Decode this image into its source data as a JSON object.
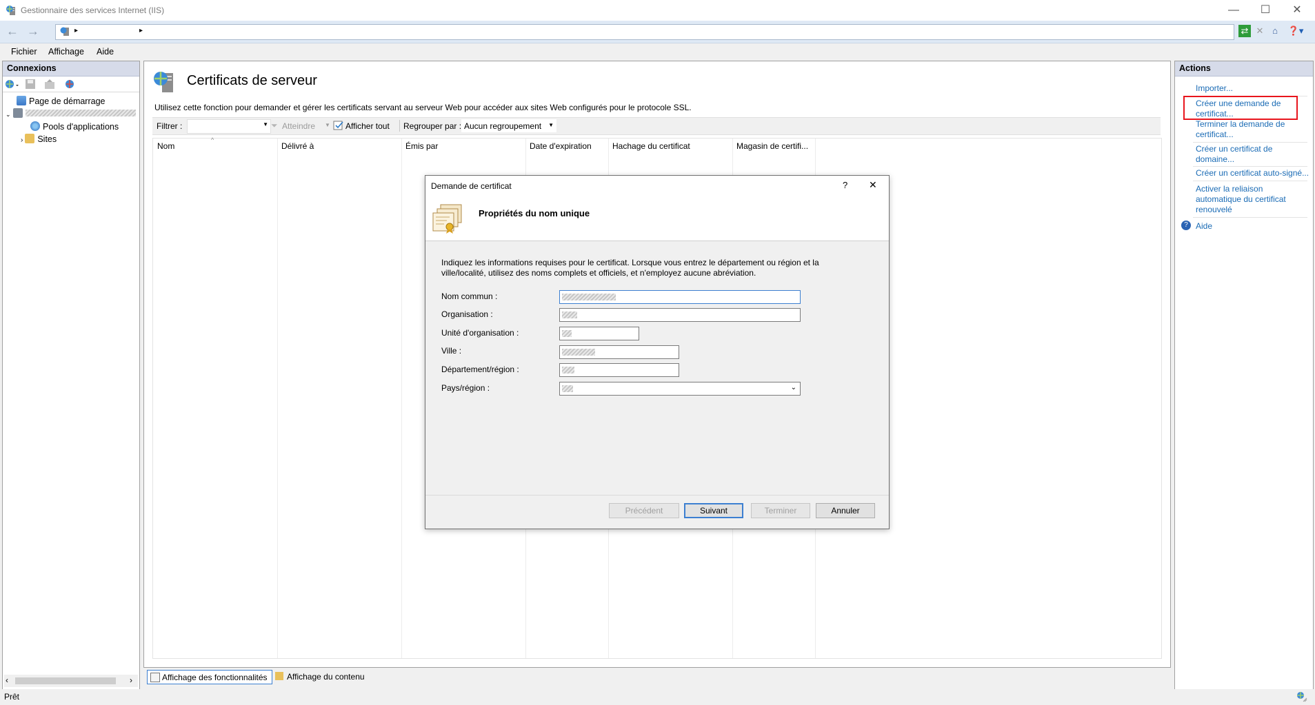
{
  "window": {
    "title": "Gestionnaire des services Internet (IIS)",
    "min_glyph": "—",
    "max_glyph": "☐",
    "close_glyph": "✕"
  },
  "address_bar": {
    "back_glyph": "←",
    "forward_glyph": "→",
    "separator": "▸"
  },
  "menu": [
    "Fichier",
    "Affichage",
    "Aide"
  ],
  "left_panel": {
    "title": "Connexions",
    "tree": {
      "start_page": "Page de démarrage",
      "app_pools": "Pools d'applications",
      "sites": "Sites"
    }
  },
  "center": {
    "title": "Certificats de serveur",
    "description": "Utilisez cette fonction pour demander et gérer les certificats servant au serveur Web pour accéder aux sites Web configurés pour le protocole SSL.",
    "filter_label": "Filtrer :",
    "go_label": "Atteindre",
    "show_all_label": "Afficher tout",
    "group_by_label": "Regrouper par :",
    "group_by_value": "Aucun regroupement",
    "columns": [
      "Nom",
      "Délivré à",
      "Émis par",
      "Date d'expiration",
      "Hachage du certificat",
      "Magasin de certifi..."
    ]
  },
  "view_tabs": {
    "features": "Affichage des fonctionnalités",
    "content": "Affichage du contenu"
  },
  "status": {
    "text": "Prêt"
  },
  "actions": {
    "title": "Actions",
    "items": [
      "Importer...",
      "Créer une demande de certificat...",
      "Terminer la demande de certificat...",
      "Créer un certificat de domaine...",
      "Créer un certificat auto-signé...",
      "Activer la reliaison automatique du certificat renouvelé",
      "Aide"
    ]
  },
  "dialog": {
    "title": "Demande de certificat",
    "help_glyph": "?",
    "close_glyph": "✕",
    "heading": "Propriétés du nom unique",
    "instructions": "Indiquez les informations requises pour le certificat. Lorsque vous entrez le département ou région et la ville/localité, utilisez des noms complets et officiels, et n'employez aucune abréviation.",
    "fields": {
      "common_name": "Nom commun :",
      "organization": "Organisation :",
      "org_unit": "Unité d'organisation :",
      "city": "Ville :",
      "state": "Département/région :",
      "country": "Pays/région :"
    },
    "buttons": {
      "previous": "Précédent",
      "next": "Suivant",
      "finish": "Terminer",
      "cancel": "Annuler"
    }
  },
  "colors": {
    "link": "#1a6bb5",
    "highlight_box": "#e8141c",
    "panel_header": "#d6dbe9",
    "address_bg": "#dfe9f5"
  }
}
